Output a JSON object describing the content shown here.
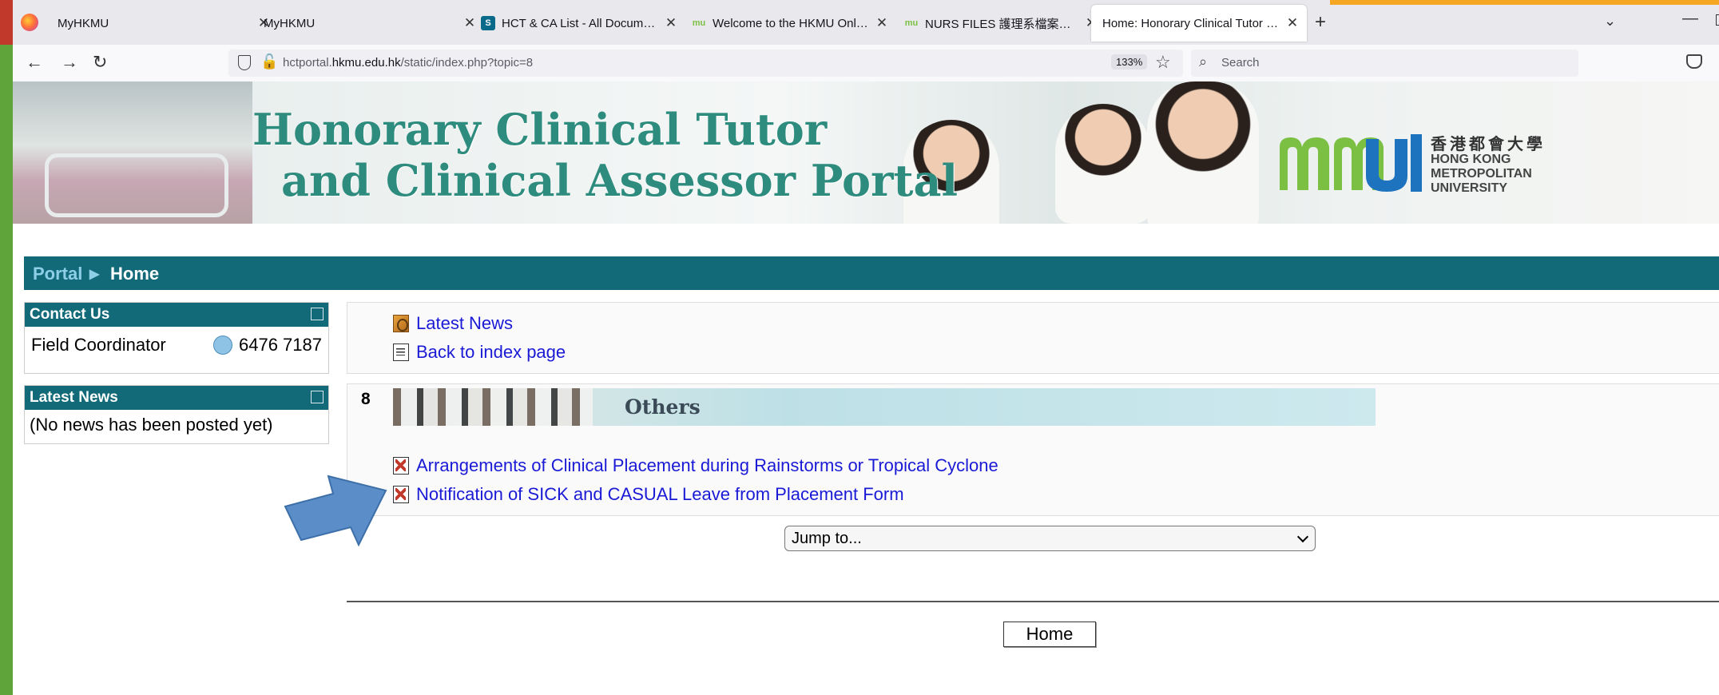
{
  "browser": {
    "tabs": [
      {
        "title": "MyHKMU",
        "favicon": "firefox-icon"
      },
      {
        "title": "MyHKMU",
        "favicon": "none"
      },
      {
        "title": "HCT & CA List - All Documents",
        "favicon": "sharepoint-icon"
      },
      {
        "title": "Welcome to the HKMU Online L",
        "favicon": "hkmu-icon"
      },
      {
        "title": "NURS FILES 護理系檔案文件發佈",
        "favicon": "hkmu-icon"
      },
      {
        "title": "Home: Honorary Clinical Tutor and",
        "favicon": "none",
        "active": true
      }
    ],
    "url_prefix": "hctportal.",
    "url_domain": "hkmu.edu.hk",
    "url_path": "/static/index.php?topic=8",
    "zoom": "133%",
    "search_placeholder": "Search"
  },
  "banner": {
    "title_line1": "Honorary Clinical Tutor",
    "title_line2": "and Clinical Assessor Portal",
    "logo_cn": "香港都會大學",
    "logo_en_lines": [
      "HONG KONG",
      "METROPOLITAN",
      "UNIVERSITY"
    ]
  },
  "breadcrumb": {
    "root": "Portal",
    "separator": "▶",
    "current": "Home"
  },
  "sidebar": {
    "contact": {
      "title": "Contact Us",
      "label": "Field Coordinator",
      "phone": "6476 7187"
    },
    "news": {
      "title": "Latest News",
      "empty_text": "(No news has been posted yet)"
    }
  },
  "main": {
    "top_links": [
      "Latest News",
      "Back to index page"
    ],
    "section_number": "8",
    "section_title": "Others",
    "section_links": [
      "Arrangements of Clinical Placement during Rainstorms or Tropical Cyclone",
      "Notification of SICK and CASUAL Leave from Placement Form"
    ],
    "jump_label": "Jump to...",
    "home_button": "Home"
  },
  "colors": {
    "teal": "#126a78",
    "link": "#1a1ad6",
    "arrow": "#5b8ec9",
    "accent_green": "#5ea43a"
  }
}
